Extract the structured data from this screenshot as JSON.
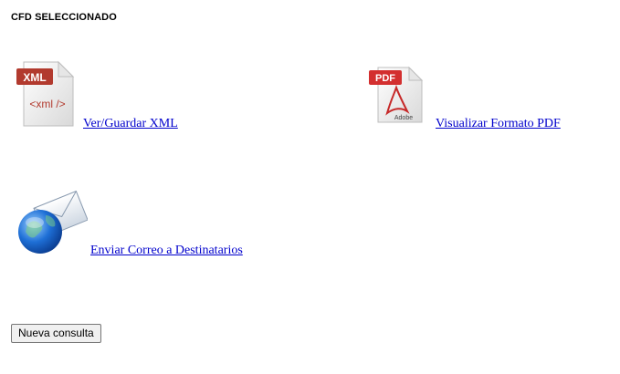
{
  "header": {
    "title": "CFD SELECCIONADO"
  },
  "actions": {
    "xml": {
      "label": "Ver/Guardar XML",
      "icon": "xml-file-icon",
      "icon_badge": "XML",
      "icon_text": "<xml />"
    },
    "pdf": {
      "label": "Visualizar Formato PDF",
      "icon": "pdf-file-icon",
      "icon_badge": "PDF",
      "icon_text": "Adobe"
    },
    "email": {
      "label": "Enviar Correo a Destinatarios",
      "icon": "email-globe-icon"
    }
  },
  "footer": {
    "new_query_label": "Nueva consulta"
  },
  "colors": {
    "link": "#0000cc",
    "xml_badge": "#c0392b",
    "pdf_badge": "#d32f2f",
    "globe": "#1e6fd6"
  }
}
